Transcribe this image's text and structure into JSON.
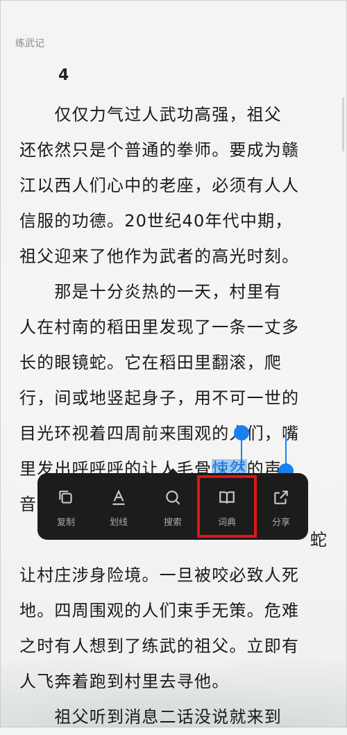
{
  "header": {
    "book_title": "练武记",
    "chapter_number": "4"
  },
  "content": {
    "lines": [
      "　　仅仅力气过人武功高强，祖父",
      "还依然只是个普通的拳师。要成为赣",
      "江以西人们心中的老座，必须有人人",
      "信服的功德。20世纪40年代中期，",
      "祖父迎来了他作为武者的高光时刻。",
      "　　那是十分炎热的一天，村里有",
      "人在村南的稻田里发现了一条一丈多",
      "长的眼镜蛇。它在稻田里翻滚，爬",
      "行，间或地竖起身子，用不可一世的",
      "目光环视着四周前来围观的人们，嘴"
    ],
    "line11_before": "里发出呼呼呼的让人毛骨",
    "line11_selected": "悚然",
    "line11_after": "的声",
    "line12_visible": "音",
    "line13_visible_end": "蛇",
    "lines_after": [
      "让村庄涉身险境。一旦被咬必致人死",
      "地。四周围观的人们束手无策。危难",
      "之时有人想到了练武的祖父。立即有",
      "人飞奔着跑到村里去寻他。",
      "　　祖父听到消息二话没说就来到"
    ]
  },
  "selection_toolbar": {
    "items": [
      {
        "label": "复制",
        "icon": "copy-icon"
      },
      {
        "label": "划线",
        "icon": "underline-icon"
      },
      {
        "label": "搜索",
        "icon": "search-icon"
      },
      {
        "label": "词典",
        "icon": "dictionary-book-icon"
      },
      {
        "label": "分享",
        "icon": "share-icon"
      }
    ],
    "highlighted_item": "词典",
    "highlight_color": "#e01515"
  },
  "colors": {
    "selection": "#1a80f0",
    "selection_bg": "#9fc9ef",
    "toolbar_bg": "#1c1c1c"
  }
}
